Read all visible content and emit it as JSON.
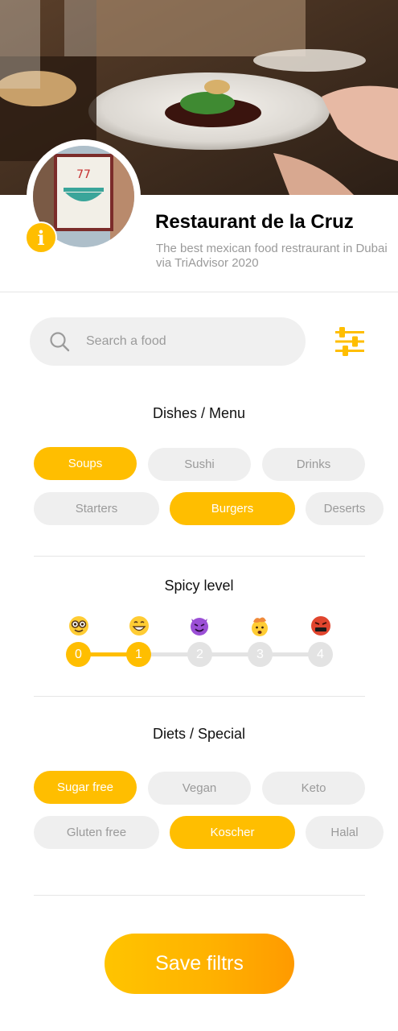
{
  "restaurant": {
    "name": "Restaurant de la Cruz",
    "tagline": "The best mexican food restraurant in Dubai via TriAdvisor 2020",
    "info_badge": "i"
  },
  "search": {
    "placeholder": "Search a food"
  },
  "dishes": {
    "title": "Dishes / Menu",
    "items": [
      {
        "label": "Soups",
        "active": true
      },
      {
        "label": "Sushi",
        "active": false
      },
      {
        "label": "Drinks",
        "active": false
      },
      {
        "label": "Starters",
        "active": false
      },
      {
        "label": "Burgers",
        "active": true
      },
      {
        "label": "Deserts",
        "active": false
      }
    ]
  },
  "spicy": {
    "title": "Spicy level",
    "levels": [
      {
        "value": "0",
        "icon": "nerd-face-emoji"
      },
      {
        "value": "1",
        "icon": "grinning-face-emoji"
      },
      {
        "value": "2",
        "icon": "smiling-devil-emoji"
      },
      {
        "value": "3",
        "icon": "exploding-head-emoji"
      },
      {
        "value": "4",
        "icon": "cursing-face-emoji"
      }
    ],
    "selected": 1
  },
  "diets": {
    "title": "Diets / Special",
    "items": [
      {
        "label": "Sugar free",
        "active": true
      },
      {
        "label": "Vegan",
        "active": false
      },
      {
        "label": "Keto",
        "active": false
      },
      {
        "label": "Gluten free",
        "active": false
      },
      {
        "label": "Koscher",
        "active": true
      },
      {
        "label": "Halal",
        "active": false
      }
    ]
  },
  "save_button": {
    "label": "Save filtrs"
  },
  "colors": {
    "accent": "#ffbe00",
    "chip_bg": "#efefef",
    "chip_text": "#9a9a9a"
  }
}
